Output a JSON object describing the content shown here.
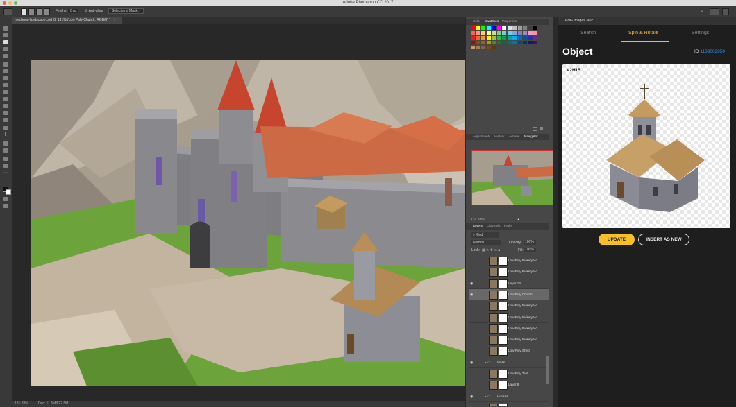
{
  "app": {
    "title": "Adobe Photoshop CC 2017"
  },
  "options_bar": {
    "feather_label": "Feather:",
    "feather_value": "0 px",
    "anti_alias_label": "Anti-alias",
    "select_mask_label": "Select and Mask..."
  },
  "document": {
    "tab_label": "medieval-landscape.psd @ 131% (Low Poly Church, RGB/8) *",
    "zoom": "131.33%",
    "doc_size": "Doc: 11.6M/622.8M"
  },
  "panels": {
    "swatch_tabs": [
      "Color",
      "Swatches",
      "Properties"
    ],
    "nav_tabs": [
      "Adjustments",
      "History",
      "Actions",
      "Navigator"
    ],
    "nav_zoom": "131.33%",
    "layers_tabs": [
      "Layers",
      "Channels",
      "Paths"
    ],
    "kind_label": "Kind",
    "blend_mode": "Normal",
    "opacity_label": "Opacity:",
    "opacity_value": "100%",
    "lock_label": "Lock:",
    "fill_label": "Fill:",
    "fill_value": "100%",
    "layers": [
      {
        "name": "Low Poly Rickety W...",
        "visible": false,
        "selected": false,
        "type": "layer"
      },
      {
        "name": "Low Poly Rickety W...",
        "visible": false,
        "selected": false,
        "type": "layer"
      },
      {
        "name": "Layer 14",
        "visible": true,
        "selected": false,
        "type": "layer"
      },
      {
        "name": "Low Poly Church",
        "visible": true,
        "selected": true,
        "type": "layer"
      },
      {
        "name": "Low Poly Rickety W...",
        "visible": false,
        "selected": false,
        "type": "layer"
      },
      {
        "name": "Low Poly Rickety W...",
        "visible": false,
        "selected": false,
        "type": "layer"
      },
      {
        "name": "Low Poly Rickety W...",
        "visible": false,
        "selected": false,
        "type": "layer"
      },
      {
        "name": "Low Poly Rickety W...",
        "visible": false,
        "selected": false,
        "type": "layer"
      },
      {
        "name": "Low Poly Shed",
        "visible": false,
        "selected": false,
        "type": "layer"
      },
      {
        "name": "Walls",
        "visible": true,
        "selected": false,
        "type": "group"
      },
      {
        "name": "Low Poly Tent",
        "visible": false,
        "selected": false,
        "type": "layer"
      },
      {
        "name": "Layer 9",
        "visible": false,
        "selected": false,
        "type": "layer"
      },
      {
        "name": "Houses",
        "visible": true,
        "selected": false,
        "type": "group"
      },
      {
        "name": "Shape 7 copy",
        "visible": false,
        "selected": false,
        "type": "layer"
      }
    ]
  },
  "plugin": {
    "title": "PNG Images 360°",
    "tabs": [
      "Search",
      "Spin & Rotate",
      "Settings"
    ],
    "active_tab": "Spin & Rotate",
    "object_title": "Object",
    "id_label": "ID",
    "id_value": "1139002950",
    "view_label": "V2H15",
    "update_button": "UPDATE",
    "insert_button": "INSERT AS NEW"
  },
  "colors": {
    "accent": "#f5c024",
    "link": "#2f8ff0",
    "roof_red": "#c7452f",
    "grass": "#6da33b",
    "stone": "#8a8a8f"
  }
}
